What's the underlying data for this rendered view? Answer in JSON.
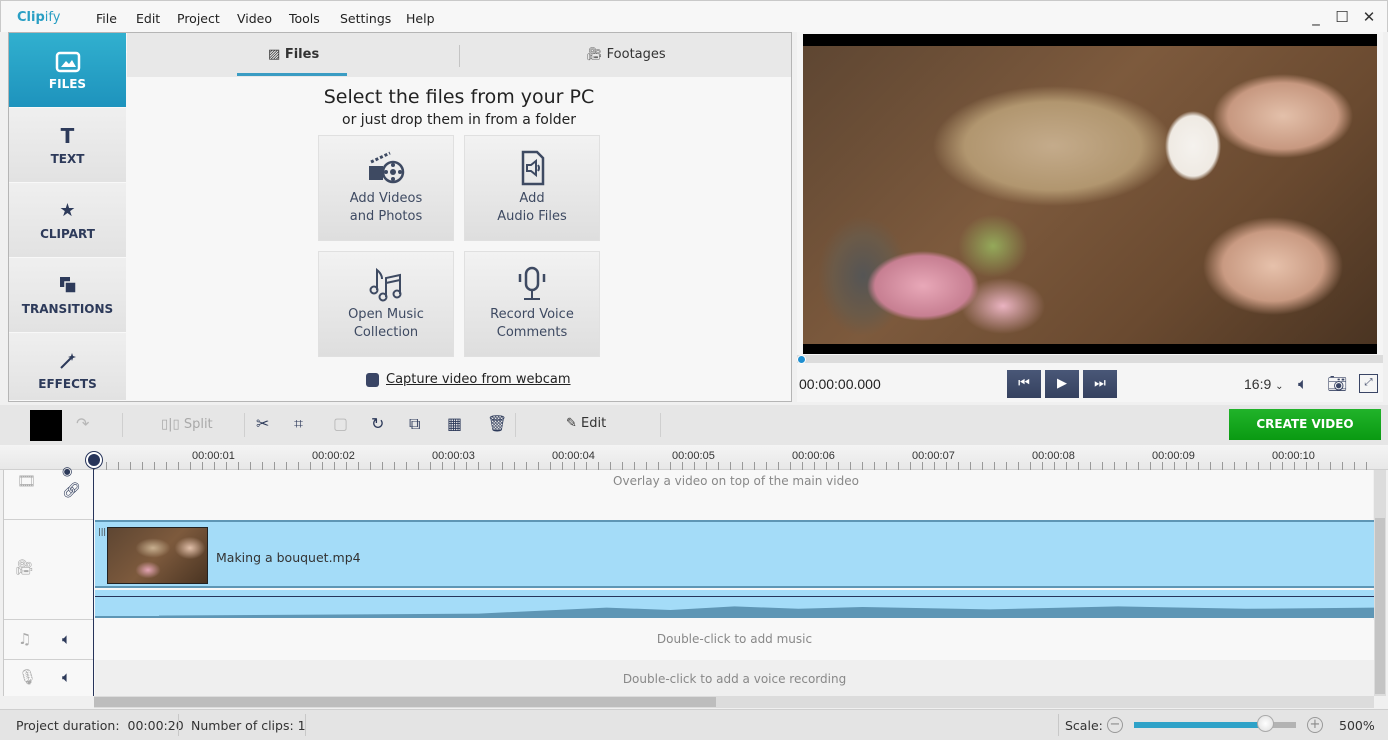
{
  "app": {
    "logo_bold": "Clip",
    "logo_rest": "ify"
  },
  "menu": [
    "File",
    "Edit",
    "Project",
    "Video",
    "Tools",
    "Settings",
    "Help"
  ],
  "window_controls": {
    "minimize": "_",
    "maximize": "☐",
    "close": "✕"
  },
  "sidebar": {
    "items": [
      {
        "label": "FILES",
        "icon": "image-icon",
        "active": true
      },
      {
        "label": "TEXT",
        "icon": "text-icon"
      },
      {
        "label": "CLIPART",
        "icon": "star-icon"
      },
      {
        "label": "TRANSITIONS",
        "icon": "transitions-icon"
      },
      {
        "label": "EFFECTS",
        "icon": "magic-wand-icon"
      }
    ]
  },
  "tabs": [
    {
      "label": "Files",
      "icon": "image-icon",
      "active": true
    },
    {
      "label": "Footages",
      "icon": "video-camera-icon"
    }
  ],
  "files_panel": {
    "heading": "Select the files from your PC",
    "subheading": "or just drop them in from a folder",
    "tiles": [
      {
        "line1": "Add Videos",
        "line2": "and Photos",
        "icon": "film-reel-icon"
      },
      {
        "line1": "Add",
        "line2": "Audio Files",
        "icon": "audio-file-icon"
      },
      {
        "line1": "Open Music",
        "line2": "Collection",
        "icon": "music-notes-icon"
      },
      {
        "line1": "Record Voice",
        "line2": "Comments",
        "icon": "microphone-icon"
      }
    ],
    "webcam_link": "Capture video from webcam"
  },
  "preview": {
    "timecode": "00:00:00.000",
    "aspect_ratio": "16:9",
    "position_fraction": 0
  },
  "toolbar": {
    "split_label": "Split",
    "edit_label": "Edit",
    "create_label": "CREATE VIDEO",
    "create_color": "#16a81e"
  },
  "ruler": {
    "ticks": [
      "00:00:01",
      "00:00:02",
      "00:00:03",
      "00:00:04",
      "00:00:05",
      "00:00:06",
      "00:00:07",
      "00:00:08",
      "00:00:09",
      "00:00:10"
    ]
  },
  "timeline": {
    "overlay_hint": "Overlay a video on top of the main video",
    "clip_name": "Making a bouquet.mp4",
    "music_hint": "Double-click to add music",
    "voice_hint": "Double-click to add a voice recording"
  },
  "status": {
    "duration_label": "Project duration:",
    "duration_value": "00:00:20",
    "clips_label": "Number of clips:",
    "clips_value": "1",
    "scale_label": "Scale:",
    "scale_value": "500%",
    "scale_fraction": 0.81
  }
}
